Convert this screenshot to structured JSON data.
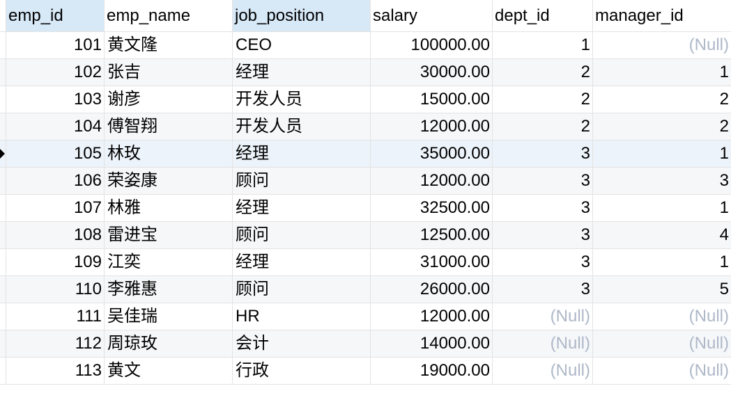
{
  "columns": [
    "emp_id",
    "emp_name",
    "job_position",
    "salary",
    "dept_id",
    "manager_id"
  ],
  "rows": [
    [
      "101",
      "黄文隆",
      "CEO",
      "100000.00",
      "1",
      "(Null)"
    ],
    [
      "102",
      "张吉",
      "经理",
      "30000.00",
      "2",
      "1"
    ],
    [
      "103",
      "谢彦",
      "开发人员",
      "15000.00",
      "2",
      "2"
    ],
    [
      "104",
      "傅智翔",
      "开发人员",
      "12000.00",
      "2",
      "2"
    ],
    [
      "105",
      "林玫",
      "经理",
      "35000.00",
      "3",
      "1"
    ],
    [
      "106",
      "荣姿康",
      "顾问",
      "12000.00",
      "3",
      "3"
    ],
    [
      "107",
      "林雅",
      "经理",
      "32500.00",
      "3",
      "1"
    ],
    [
      "108",
      "雷进宝",
      "顾问",
      "12500.00",
      "3",
      "4"
    ],
    [
      "109",
      "江奕",
      "经理",
      "31000.00",
      "3",
      "1"
    ],
    [
      "110",
      "李雅惠",
      "顾问",
      "26000.00",
      "3",
      "5"
    ],
    [
      "111",
      "吴佳瑞",
      "HR",
      "12000.00",
      "(Null)",
      "(Null)"
    ],
    [
      "112",
      "周琼玫",
      "会计",
      "14000.00",
      "(Null)",
      "(Null)"
    ],
    [
      "113",
      "黄文",
      "行政",
      "19000.00",
      "(Null)",
      "(Null)"
    ]
  ],
  "current_row_index": 4,
  "null_text": "(Null)",
  "colors": {
    "header_selected": "#d7e8f7",
    "row_alt": "#f6f7f9",
    "row_selected": "#edf3fa",
    "null_text": "#aeb8c8",
    "grid_line": "#e3e3e3"
  }
}
